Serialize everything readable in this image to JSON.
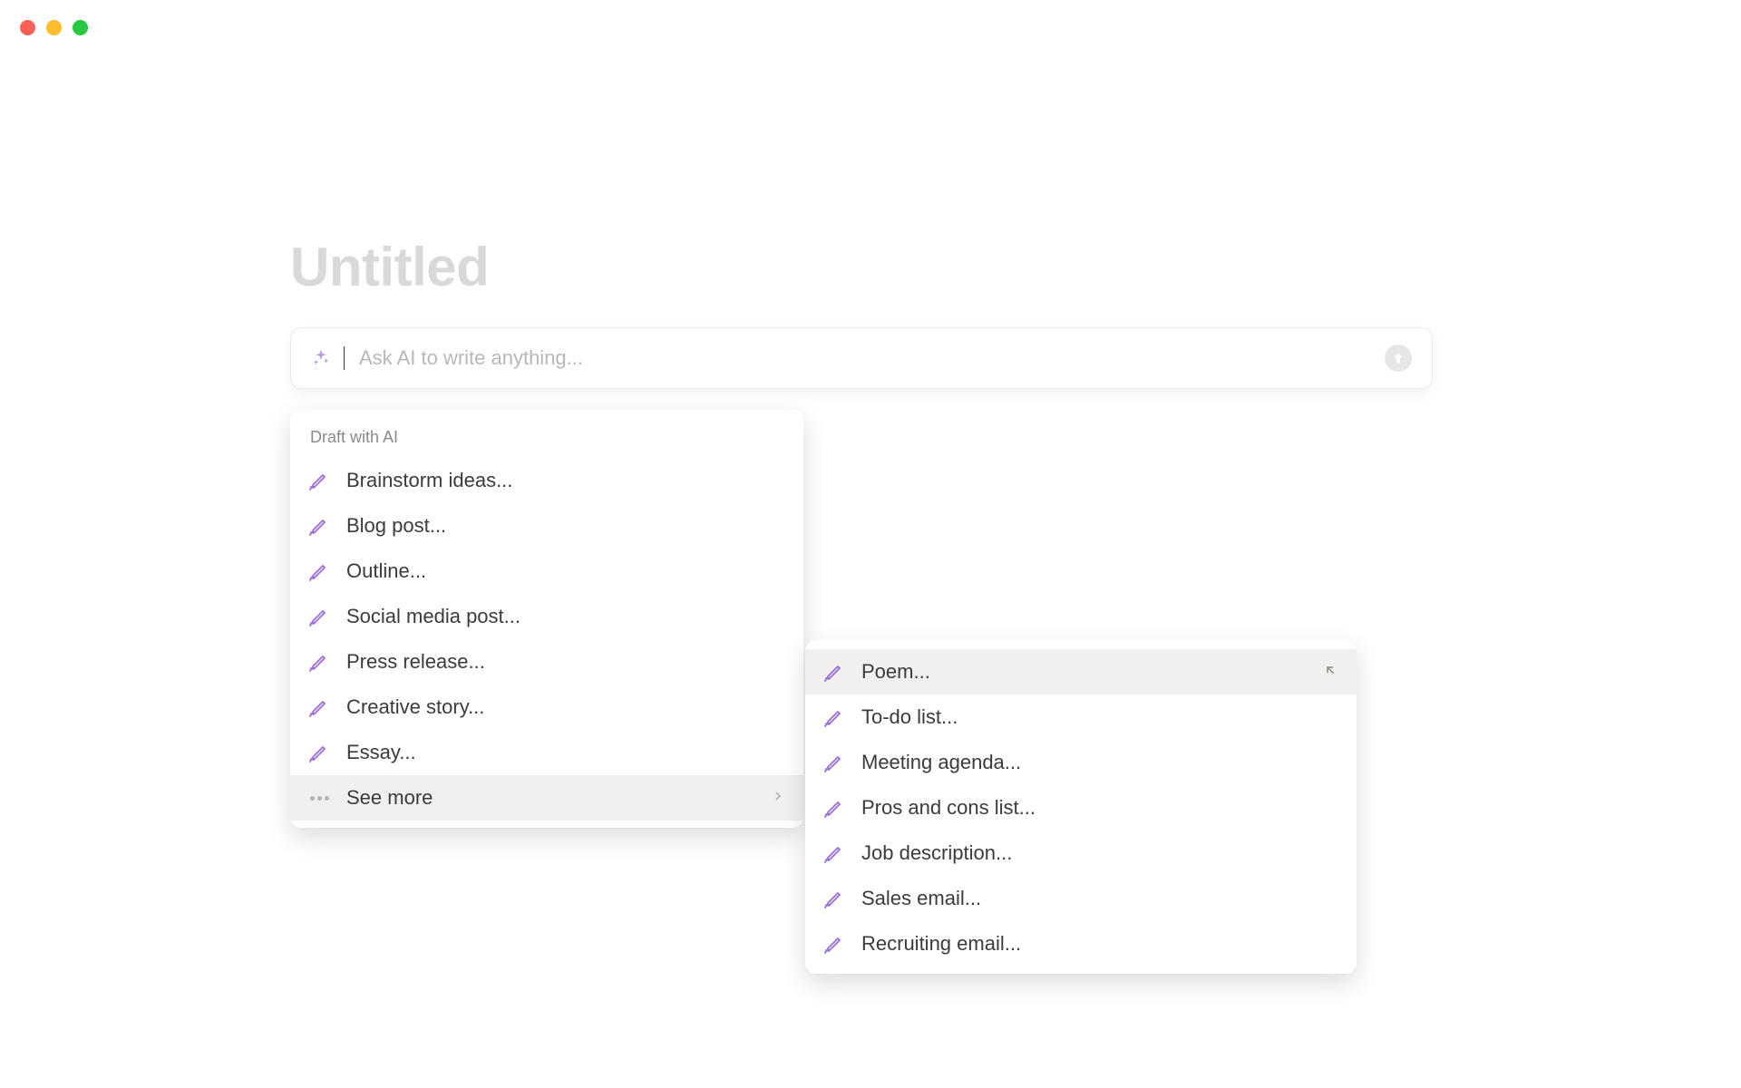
{
  "page": {
    "title": "Untitled"
  },
  "ai_bar": {
    "placeholder": "Ask AI to write anything..."
  },
  "primary_menu": {
    "header": "Draft with AI",
    "items": [
      {
        "label": "Brainstorm ideas..."
      },
      {
        "label": "Blog post..."
      },
      {
        "label": "Outline..."
      },
      {
        "label": "Social media post..."
      },
      {
        "label": "Press release..."
      },
      {
        "label": "Creative story..."
      },
      {
        "label": "Essay..."
      }
    ],
    "see_more": {
      "label": "See more"
    }
  },
  "secondary_menu": {
    "items": [
      {
        "label": "Poem..."
      },
      {
        "label": "To-do list..."
      },
      {
        "label": "Meeting agenda..."
      },
      {
        "label": "Pros and cons list..."
      },
      {
        "label": "Job description..."
      },
      {
        "label": "Sales email..."
      },
      {
        "label": "Recruiting email..."
      }
    ]
  },
  "colors": {
    "accent_purple": "#9a6dd7",
    "text_muted": "#b8b7b4"
  }
}
